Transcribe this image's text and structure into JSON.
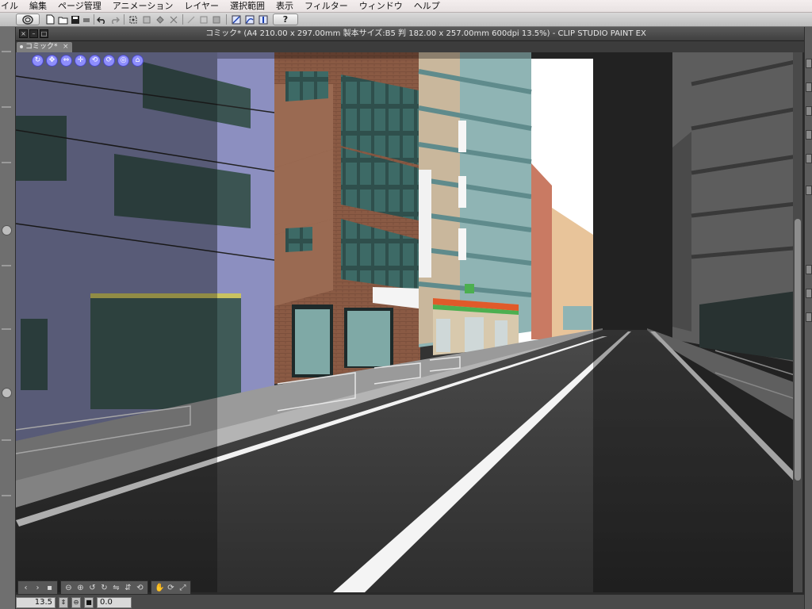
{
  "menubar": {
    "items": [
      "イル",
      "編集",
      "ページ管理",
      "アニメーション",
      "レイヤー",
      "選択範囲",
      "表示",
      "フィルター",
      "ウィンドウ",
      "ヘルプ"
    ]
  },
  "commandbar": {
    "icons": [
      "app-logo-icon",
      "new-file-icon",
      "open-file-icon",
      "save-icon",
      "print-icon",
      "undo-icon",
      "redo-icon",
      "transform-icon",
      "clear-icon",
      "fill-icon",
      "select-icon",
      "ruler-icon",
      "snap-ruler-icon",
      "snap-grid-icon",
      "help-icon"
    ],
    "help_label": "?"
  },
  "document": {
    "title": "コミック* (A4 210.00 x 297.00mm 製本サイズ:B5 判 182.00 x 257.00mm 600dpi 13.5%)  - CLIP STUDIO PAINT EX",
    "tab_label": "コミック*"
  },
  "object_toolbar": {
    "icons": [
      "rotate-camera-icon",
      "move-camera-icon",
      "pan-camera-icon",
      "move-object-icon",
      "rotate-object-icon",
      "rotate-object-alt-icon",
      "scale-object-icon",
      "set-object-icon"
    ]
  },
  "navigator": {
    "zoom": "13.5",
    "angle": "0.0",
    "icons": [
      "scroll-left-icon",
      "scroll-right-icon",
      "fit-page-icon",
      "zoom-out-icon",
      "zoom-in-icon",
      "rotate-left-icon",
      "rotate-right-icon",
      "flip-horizontal-icon",
      "flip-vertical-icon",
      "reset-rotate-icon",
      "hand-tool-icon",
      "rotate-tool-icon",
      "reset-view-icon"
    ]
  },
  "colors": {
    "accent": "#8e8efc",
    "sky": "#ffffff",
    "road": "#3a3a3a"
  }
}
